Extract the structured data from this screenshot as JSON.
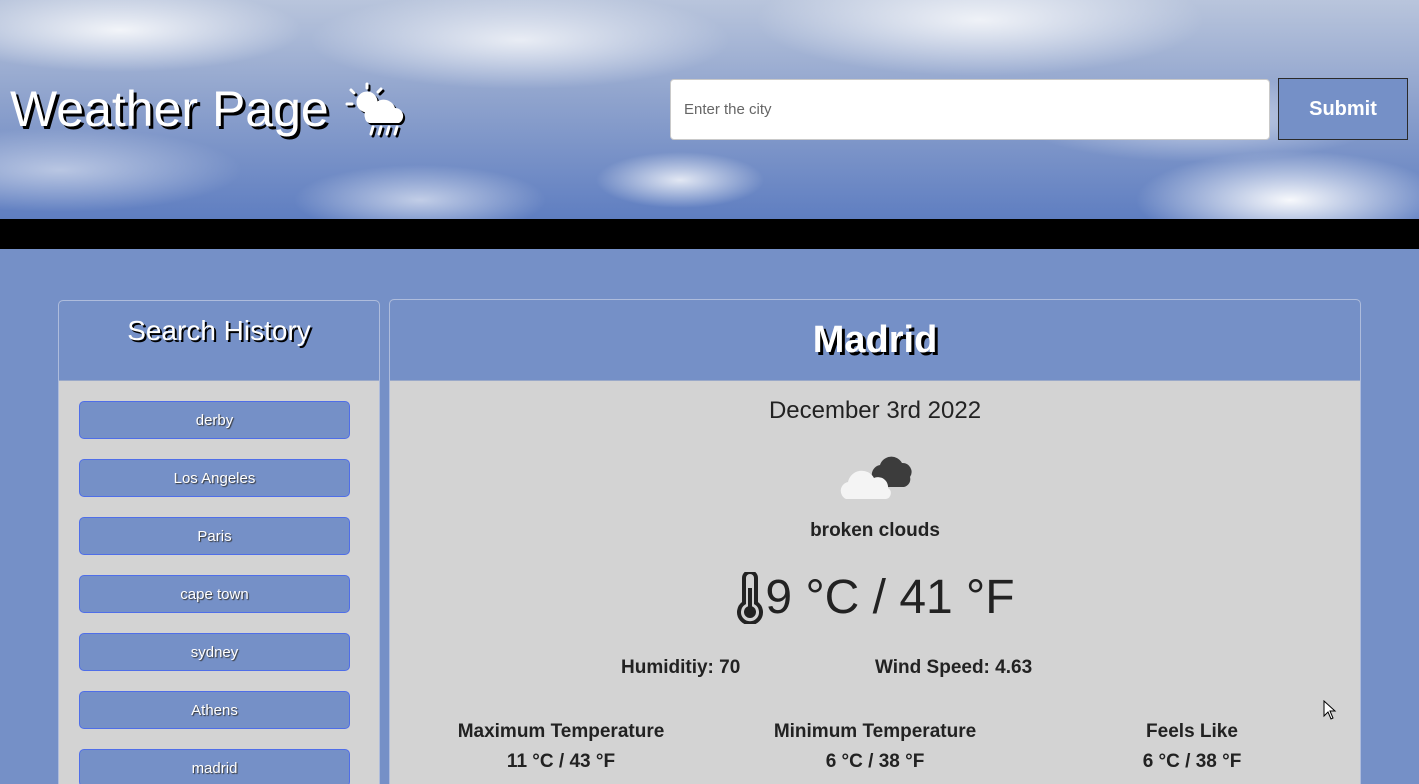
{
  "header": {
    "title": "Weather Page",
    "search": {
      "placeholder": "Enter the city",
      "value": ""
    },
    "submit_label": "Submit"
  },
  "sidebar": {
    "title": "Search History",
    "items": [
      {
        "label": "derby"
      },
      {
        "label": "Los Angeles"
      },
      {
        "label": "Paris"
      },
      {
        "label": "cape town"
      },
      {
        "label": "sydney"
      },
      {
        "label": "Athens"
      },
      {
        "label": "madrid"
      }
    ]
  },
  "weather": {
    "city": "Madrid",
    "date": "December 3rd 2022",
    "description": "broken clouds",
    "temperature": "9 °C / 41 °F",
    "humidity": "Humiditiy: 70",
    "wind_speed": "Wind Speed: 4.63",
    "max_label": "Maximum Temperature",
    "max_value": "11 °C / 43 °F",
    "min_label": "Minimum Temperature",
    "min_value": "6 °C / 38 °F",
    "feels_label": "Feels Like",
    "feels_value": "6 °C / 38 °F"
  },
  "colors": {
    "page_bg": "#7590c7",
    "card_bg": "#d3d3d3",
    "history_border": "#4f6ee8",
    "black_bar": "#000000"
  }
}
